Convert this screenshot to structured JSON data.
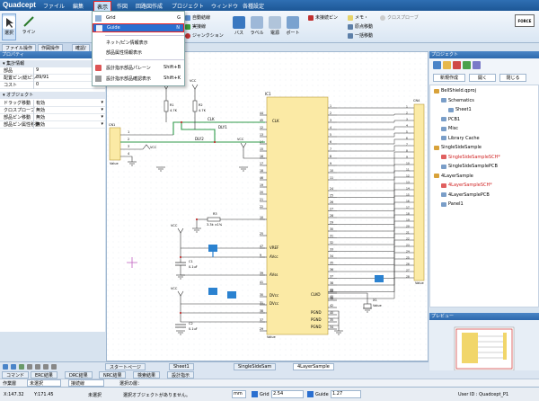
{
  "app": {
    "logo": "Quadcept"
  },
  "menubar": {
    "items": [
      "ファイル",
      "編集",
      "表示",
      "作図",
      "回路図作成",
      "プロジェクト",
      "ウィンドウ",
      "各種設定"
    ],
    "active": "表示"
  },
  "ribbon": {
    "select": "選択",
    "line": "ライン",
    "auto_wiring": "自動結線",
    "line_wiring": "実接線",
    "junction": "ジャンクション",
    "bus": "バス",
    "label": "ラベル",
    "power": "電源",
    "port": "ポート",
    "no_connect": "未接続ピン",
    "memo": "メモ・",
    "origin": "原点移動",
    "bulk_move": "一括移動",
    "cross_probe": "クロスプローブ",
    "force": "FORCE"
  },
  "dropdown": {
    "items": [
      {
        "label": "Grid",
        "shortcut": "G"
      },
      {
        "label": "Guide",
        "shortcut": "N"
      },
      {
        "label": "ネット/ピン情報表示",
        "shortcut": ""
      },
      {
        "label": "部品属性情報表示",
        "shortcut": ""
      },
      {
        "label": "設計指示部品パレーン",
        "shortcut": "Shift+B"
      },
      {
        "label": "設計指示部品確認表示",
        "shortcut": "Shift+K"
      }
    ]
  },
  "left": {
    "tabs": [
      "ファイル操作",
      "作図操作",
      "確認/"
    ],
    "panel_title": "プロパティ",
    "group_summary": "▾ 集計情報",
    "summary_rows": [
      {
        "k": "部品",
        "v": "9"
      },
      {
        "k": "配置ピン/総ピン",
        "v": "89/91"
      },
      {
        "k": "コスト",
        "v": "0"
      }
    ],
    "group_object": "▾ オブジェクト",
    "object_rows": [
      {
        "k": "ドラッグ移動",
        "v": "有効"
      },
      {
        "k": "クロスプローブ",
        "v": "無効"
      },
      {
        "k": "部品ピン移動",
        "v": "無効"
      },
      {
        "k": "部品ピン属性移動",
        "v": "無効"
      }
    ]
  },
  "schematic": {
    "cn1": "CN1",
    "cn1_value": "Value",
    "cn1_pins": [
      "1",
      "2",
      "3",
      "4"
    ],
    "ic1": "IC1",
    "ic1_value": "Value",
    "cn4": "CN4",
    "cn4_value": "Value",
    "r1": "R1",
    "r1_val": "4.7K",
    "r2": "R2",
    "r2_val": "4.7K",
    "r3": "R3",
    "r3_val": "3.3k ±1%",
    "vcc": "VCC",
    "clk": "CLK",
    "dly1": "DLY1",
    "dly2": "DLY2",
    "left_pins": [
      "44",
      "45",
      "12",
      "13",
      "14",
      "15",
      "16",
      "17",
      "18",
      "46",
      "19",
      "20",
      "21",
      "22",
      "10",
      "25",
      "47",
      "9",
      "39",
      "41",
      "30",
      "31",
      "38",
      "37",
      "29"
    ],
    "left_labels": [
      "CLK",
      "VREF",
      "AVcc",
      "AVss",
      "DVcc",
      "DVcc"
    ],
    "right_pins": [
      "1",
      "2",
      "3",
      "4",
      "5",
      "6",
      "7",
      "8",
      "9",
      "10",
      "11",
      "12",
      "13",
      "14",
      "15",
      "16",
      "17",
      "18",
      "19",
      "20",
      "21",
      "22",
      "23",
      "24",
      "25",
      "26",
      "27",
      "28",
      "29",
      "30",
      "31",
      "32",
      "33",
      "34",
      "35",
      "36",
      "37",
      "38",
      "39",
      "40"
    ],
    "ic_right_pins": [
      "1",
      "2",
      "3",
      "4",
      "5",
      "6",
      "7",
      "8",
      "9",
      "10",
      "11",
      "24",
      "25",
      "26",
      "27",
      "28",
      "29",
      "30",
      "31",
      "32",
      "33",
      "34",
      "35",
      "36",
      "37",
      "38",
      "39",
      "40",
      "50",
      "48",
      "42",
      "40",
      "35",
      "34",
      "43"
    ],
    "right_labels": [
      "CLKO",
      "PGND",
      "PGND",
      "PGND"
    ],
    "c1": "C1",
    "c1_val": "0.1uF",
    "c2": "C2",
    "c2_val": "0.1uF",
    "x1": "X1",
    "x1_val": "Value"
  },
  "right": {
    "panel_title": "プロジェクト",
    "buttons": [
      "新規作成",
      "開く",
      "閉じる"
    ],
    "tree": [
      {
        "label": "BellShield.qproj",
        "level": 0,
        "color": "#000"
      },
      {
        "label": "Schematics",
        "level": 1,
        "color": "#000"
      },
      {
        "label": "Sheet1",
        "level": 2,
        "color": "#000"
      },
      {
        "label": "PCB1",
        "level": 1,
        "color": "#000"
      },
      {
        "label": "Misc",
        "level": 1,
        "color": "#000"
      },
      {
        "label": "Library Cache",
        "level": 1,
        "color": "#000"
      },
      {
        "label": "SingleSideSample",
        "level": 0,
        "color": "#000"
      },
      {
        "label": "SingleSideSampleSCH*",
        "level": 1,
        "color": "#d02020"
      },
      {
        "label": "SingleSideSamplePCB",
        "level": 1,
        "color": "#000"
      },
      {
        "label": "4LayerSample",
        "level": 0,
        "color": "#000"
      },
      {
        "label": "4LayerSampleSCH*",
        "level": 1,
        "color": "#d02020"
      },
      {
        "label": "4LayerSamplePCB",
        "level": 1,
        "color": "#000"
      },
      {
        "label": "Panel1",
        "level": 1,
        "color": "#000"
      }
    ],
    "preview_title": "プレビュー"
  },
  "doc_tabs": [
    "スタートページ",
    "Sheet1",
    "SingleSideSam",
    "4LayerSample"
  ],
  "msg_tabs": [
    "コマンド",
    "ERC結果",
    "DRC結果",
    "NRC結果",
    "検索結果",
    "設計指示"
  ],
  "workbar": {
    "label": "作業層",
    "value": "未選択",
    "mode": "接続線",
    "info": "選択の層："
  },
  "status": {
    "x": "X:147.32",
    "y": "Y:171.45",
    "state": "未選択",
    "message": "選択オブジェクトがありません。",
    "unit": "mm",
    "grid_label": "Grid",
    "grid_value": "2.54",
    "guide_label": "Guide",
    "guide_value": "1.27",
    "user": "User ID : Quadcept_P1"
  }
}
